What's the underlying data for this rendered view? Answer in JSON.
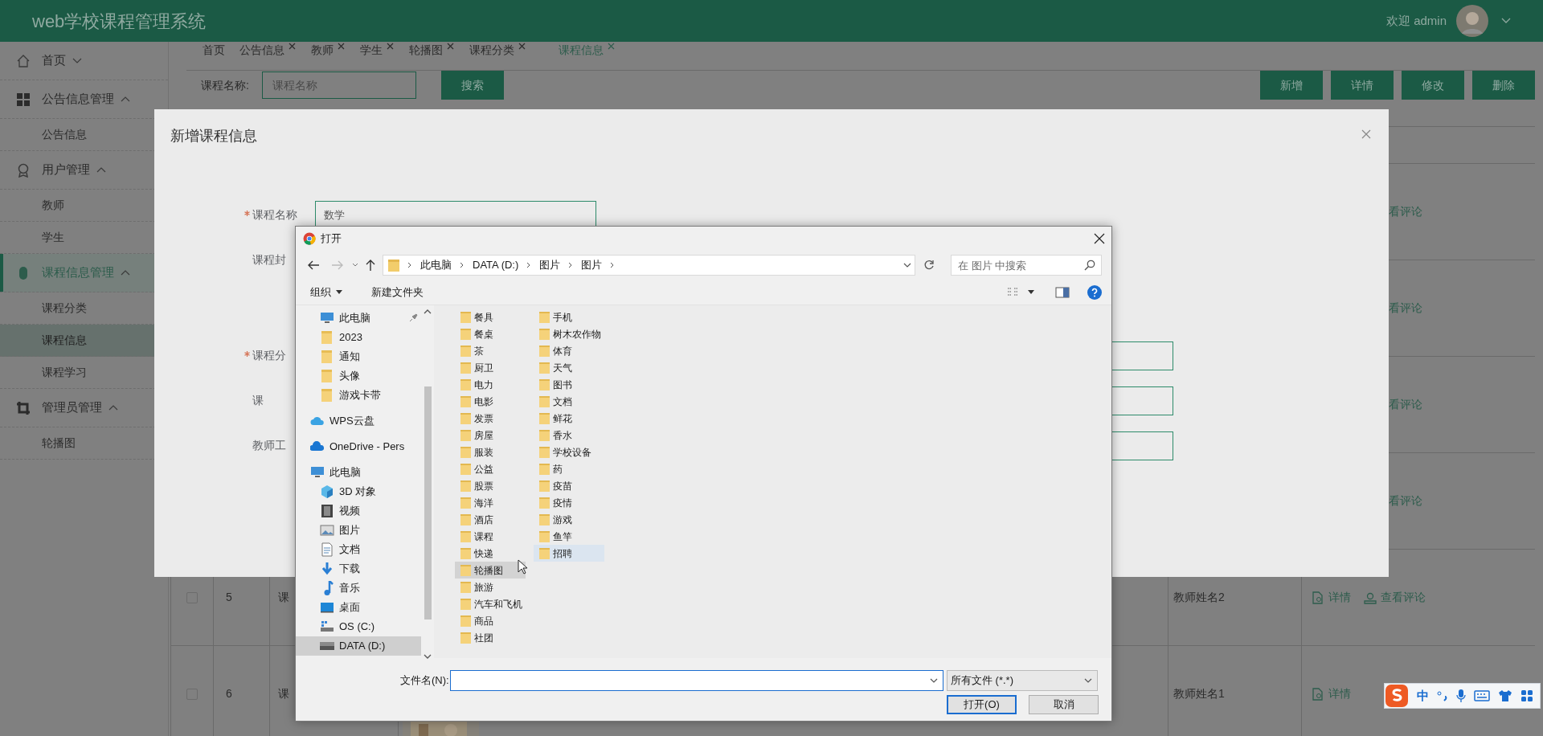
{
  "header": {
    "title": "web学校课程管理系统",
    "welcome": "欢迎 admin"
  },
  "sidebar": [
    {
      "kind": "group",
      "label": "首页",
      "expanded": false,
      "active": false
    },
    {
      "kind": "group",
      "label": "公告信息管理",
      "expanded": true,
      "active": false
    },
    {
      "kind": "item",
      "label": "公告信息",
      "selected": false
    },
    {
      "kind": "group",
      "label": "用户管理",
      "expanded": true,
      "active": false
    },
    {
      "kind": "item",
      "label": "教师",
      "selected": false
    },
    {
      "kind": "item",
      "label": "学生",
      "selected": false
    },
    {
      "kind": "group",
      "label": "课程信息管理",
      "expanded": true,
      "active": true
    },
    {
      "kind": "item",
      "label": "课程分类",
      "selected": false
    },
    {
      "kind": "item",
      "label": "课程信息",
      "selected": true
    },
    {
      "kind": "item",
      "label": "课程学习",
      "selected": false
    },
    {
      "kind": "group",
      "label": "管理员管理",
      "expanded": true,
      "active": false
    },
    {
      "kind": "item",
      "label": "轮播图",
      "selected": false
    }
  ],
  "tabs": [
    {
      "label": "首页",
      "closable": false,
      "selected": false
    },
    {
      "label": "公告信息",
      "closable": true,
      "selected": false
    },
    {
      "label": "教师",
      "closable": true,
      "selected": false
    },
    {
      "label": "学生",
      "closable": true,
      "selected": false
    },
    {
      "label": "轮播图",
      "closable": true,
      "selected": false
    },
    {
      "label": "课程分类",
      "closable": true,
      "selected": false
    },
    {
      "label": "课程信息",
      "closable": true,
      "selected": true
    }
  ],
  "search": {
    "label": "课程名称:",
    "placeholder": "课程名称",
    "button": "搜索"
  },
  "actions": [
    "新增",
    "详情",
    "修改",
    "删除"
  ],
  "table": {
    "rows": [
      {
        "comments": "看评论"
      },
      {
        "comments": "看评论"
      },
      {
        "comments": "看评论"
      },
      {
        "comments": "看评论"
      },
      {
        "checked": false,
        "index": "5",
        "course": "课",
        "teacher": "教师姓名2",
        "detail": "详情",
        "comments": "查看评论"
      },
      {
        "checked": false,
        "index": "6",
        "course": "课",
        "teacher": "教师姓名1",
        "detail": "详情"
      }
    ]
  },
  "modal": {
    "title": "新增课程信息",
    "fields": [
      {
        "label": "课程名称",
        "required": true,
        "value": "数学"
      },
      {
        "label": "课程封",
        "required": false
      },
      {
        "label": "课程分",
        "required": true
      },
      {
        "label": "课",
        "required": false
      },
      {
        "label": "教师工",
        "required": false
      }
    ]
  },
  "file_dialog": {
    "title": "打开",
    "path": [
      "此电脑",
      "DATA (D:)",
      "图片",
      "图片"
    ],
    "search_placeholder": "在 图片 中搜索",
    "toolbar": {
      "organize": "组织",
      "new_folder": "新建文件夹"
    },
    "nav": [
      {
        "kind": "pc",
        "label": "此电脑",
        "pinned": true,
        "selected": false
      },
      {
        "kind": "folder",
        "label": "2023",
        "pinned": false,
        "selected": false
      },
      {
        "kind": "folder",
        "label": "通知",
        "pinned": false,
        "selected": false
      },
      {
        "kind": "folder",
        "label": "头像",
        "pinned": false,
        "selected": false
      },
      {
        "kind": "folder",
        "label": "游戏卡带",
        "pinned": false,
        "selected": false
      },
      {
        "kind": "cloud",
        "label": "WPS云盘",
        "pinned": false,
        "selected": false
      },
      {
        "kind": "onedrive",
        "label": "OneDrive - Pers",
        "pinned": false,
        "selected": false
      },
      {
        "kind": "pc",
        "label": "此电脑",
        "pinned": false,
        "selected": false,
        "children": [
          {
            "kind": "cube",
            "label": "3D 对象",
            "pinned": false,
            "selected": false
          },
          {
            "kind": "video",
            "label": "视频",
            "pinned": false,
            "selected": false
          },
          {
            "kind": "pictures",
            "label": "图片",
            "pinned": false,
            "selected": false
          },
          {
            "kind": "docs",
            "label": "文档",
            "pinned": false,
            "selected": false
          },
          {
            "kind": "download",
            "label": "下载",
            "pinned": false,
            "selected": false
          },
          {
            "kind": "music",
            "label": "音乐",
            "pinned": false,
            "selected": false
          },
          {
            "kind": "desktop",
            "label": "桌面",
            "pinned": false,
            "selected": false
          },
          {
            "kind": "osdrive",
            "label": "OS (C:)",
            "pinned": false,
            "selected": false
          },
          {
            "kind": "drive",
            "label": "DATA (D:)",
            "pinned": false,
            "selected": true
          }
        ]
      }
    ],
    "folders": [
      [
        {
          "name": "餐具",
          "selected": false,
          "hovered": false
        },
        {
          "name": "餐桌",
          "selected": false,
          "hovered": false
        },
        {
          "name": "茶",
          "selected": false,
          "hovered": false
        },
        {
          "name": "厨卫",
          "selected": false,
          "hovered": false
        },
        {
          "name": "电力",
          "selected": false,
          "hovered": false
        },
        {
          "name": "电影",
          "selected": false,
          "hovered": false
        },
        {
          "name": "发票",
          "selected": false,
          "hovered": false
        },
        {
          "name": "房屋",
          "selected": false,
          "hovered": false
        },
        {
          "name": "服装",
          "selected": false,
          "hovered": false
        },
        {
          "name": "公益",
          "selected": false,
          "hovered": false
        },
        {
          "name": "股票",
          "selected": false,
          "hovered": false
        },
        {
          "name": "海洋",
          "selected": false,
          "hovered": false
        },
        {
          "name": "酒店",
          "selected": false,
          "hovered": false
        },
        {
          "name": "课程",
          "selected": false,
          "hovered": false
        },
        {
          "name": "快递",
          "selected": false,
          "hovered": false
        },
        {
          "name": "轮播图",
          "selected": true,
          "hovered": false
        },
        {
          "name": "旅游",
          "selected": false,
          "hovered": false
        },
        {
          "name": "汽车和飞机",
          "selected": false,
          "hovered": false
        },
        {
          "name": "商品",
          "selected": false,
          "hovered": false
        },
        {
          "name": "社团",
          "selected": false,
          "hovered": false
        }
      ],
      [
        {
          "name": "手机",
          "selected": false,
          "hovered": false
        },
        {
          "name": "树木农作物",
          "selected": false,
          "hovered": false
        },
        {
          "name": "体育",
          "selected": false,
          "hovered": false
        },
        {
          "name": "天气",
          "selected": false,
          "hovered": false
        },
        {
          "name": "图书",
          "selected": false,
          "hovered": false
        },
        {
          "name": "文档",
          "selected": false,
          "hovered": false
        },
        {
          "name": "鲜花",
          "selected": false,
          "hovered": false
        },
        {
          "name": "香水",
          "selected": false,
          "hovered": false
        },
        {
          "name": "学校设备",
          "selected": false,
          "hovered": false
        },
        {
          "name": "药",
          "selected": false,
          "hovered": false
        },
        {
          "name": "疫苗",
          "selected": false,
          "hovered": false
        },
        {
          "name": "疫情",
          "selected": false,
          "hovered": false
        },
        {
          "name": "游戏",
          "selected": false,
          "hovered": false
        },
        {
          "name": "鱼竿",
          "selected": false,
          "hovered": false
        },
        {
          "name": "招聘",
          "selected": false,
          "hovered": true
        }
      ]
    ],
    "filename_label": "文件名(N):",
    "filetype": "所有文件 (*.*)",
    "buttons": [
      {
        "label": "打开(O)",
        "default": true
      },
      {
        "label": "取消",
        "default": false
      }
    ]
  },
  "ime": {
    "mode": "中"
  }
}
